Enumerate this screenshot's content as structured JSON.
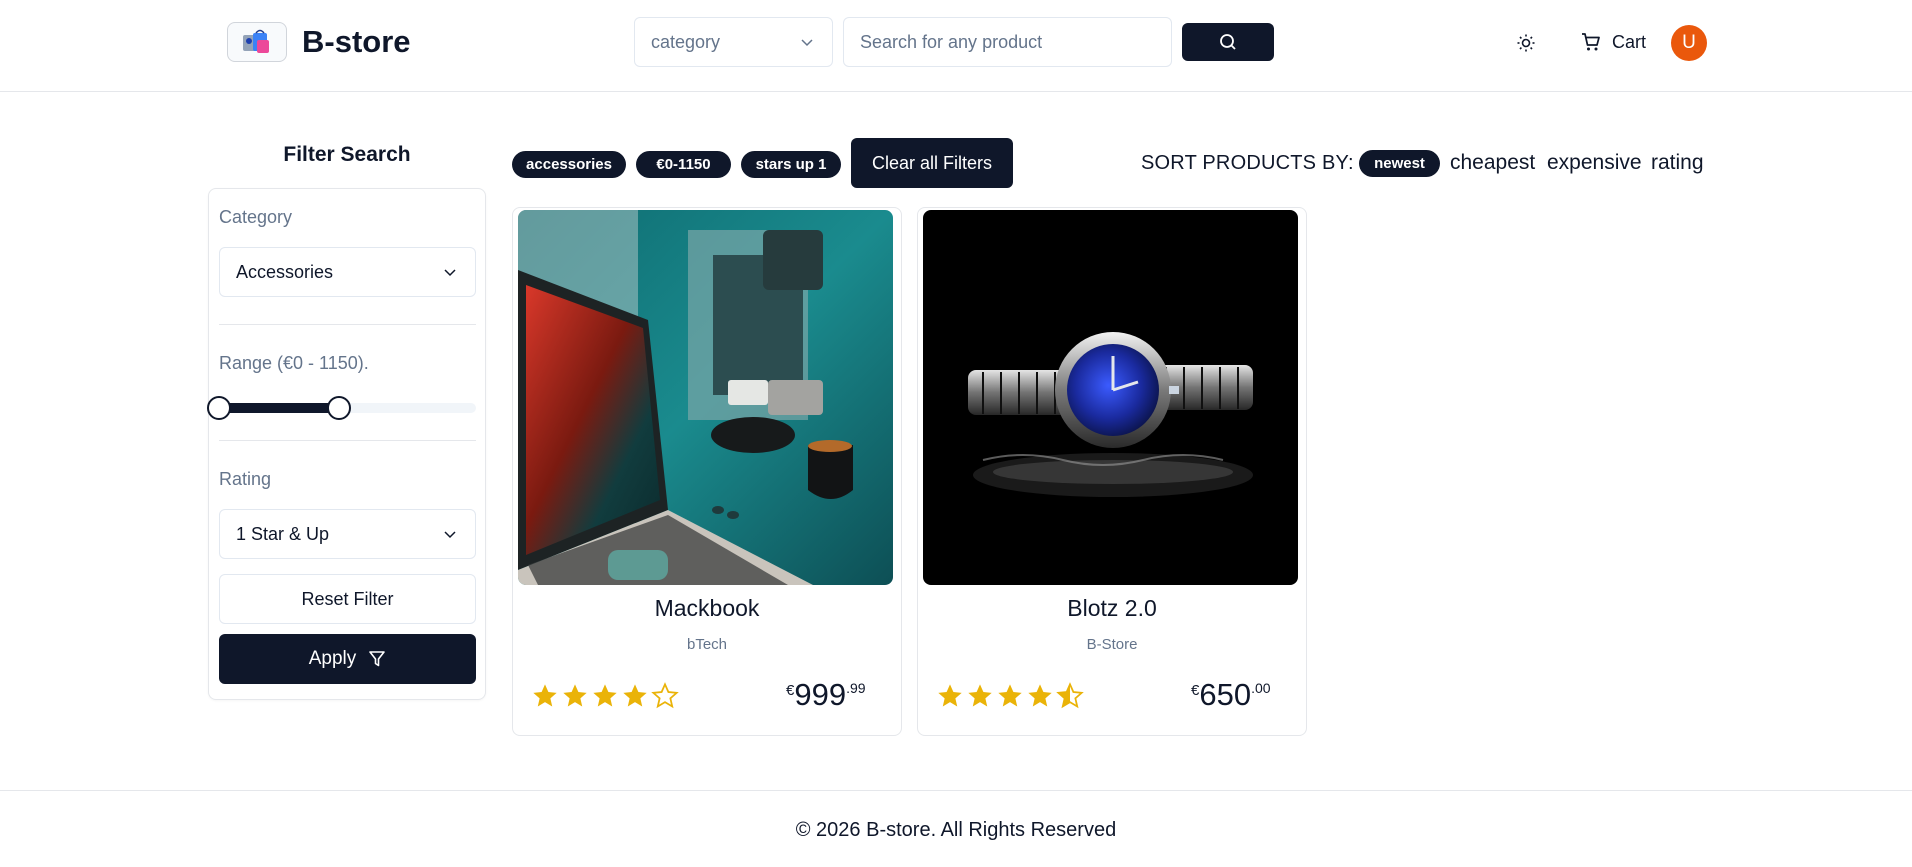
{
  "header": {
    "brand": "B-store",
    "logo_icon": "shopping-bags-icon",
    "category_select": {
      "value": "category"
    },
    "search": {
      "placeholder": "Search for any product",
      "value": ""
    },
    "cart_label": "Cart",
    "avatar_initial": "U",
    "colors": {
      "primary": "#0f172a",
      "avatar": "#ea580c"
    }
  },
  "sidebar": {
    "title": "Filter Search",
    "category_label": "Category",
    "category_value": "Accessories",
    "range_label": "Range (€0 - 1150).",
    "range_min_fraction": 0.0,
    "range_max_fraction": 0.465,
    "rating_label": "Rating",
    "rating_value": "1 Star & Up",
    "reset_label": "Reset Filter",
    "apply_label": "Apply"
  },
  "active_filters": [
    "accessories",
    "€0-1150",
    "stars up 1"
  ],
  "clear_filters_label": "Clear all Filters",
  "sort": {
    "label": "SORT PRODUCTS BY:",
    "options": [
      "newest",
      "cheapest",
      "expensive",
      "rating"
    ],
    "active": "newest"
  },
  "products": [
    {
      "name": "Mackbook",
      "brand": "bTech",
      "rating": 4,
      "currency": "€",
      "price_main": "999",
      "price_cents": ".99",
      "image": "laptop-and-coffee-photo"
    },
    {
      "name": "Blotz 2.0",
      "brand": "B-Store",
      "rating": 4.5,
      "currency": "€",
      "price_main": "650",
      "price_cents": ".00",
      "image": "wristwatch-photo"
    }
  ],
  "star_color": "#eab308",
  "footer": {
    "text": "© 2026 B-store. All Rights Reserved"
  }
}
